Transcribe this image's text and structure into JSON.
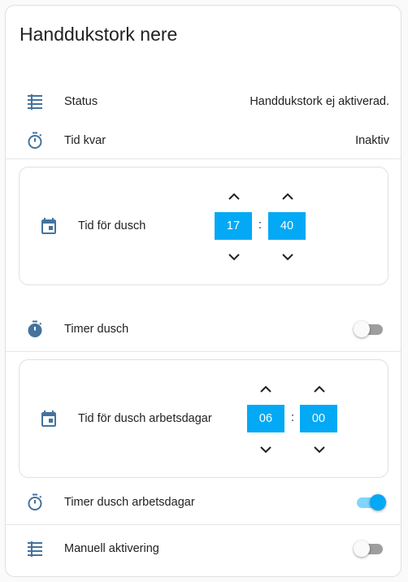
{
  "card": {
    "title": "Handdukstork nere"
  },
  "rows": {
    "status": {
      "label": "Status",
      "value": "Handdukstork ej aktiverad.",
      "icon": "list-icon"
    },
    "tid_kvar": {
      "label": "Tid kvar",
      "value": "Inaktiv",
      "icon": "timer-outline-icon"
    }
  },
  "time_dusch": {
    "label": "Tid för dusch",
    "hour": "17",
    "sep": ":",
    "minute": "40",
    "icon": "calendar-icon"
  },
  "timer_dusch": {
    "label": "Timer dusch",
    "state": "off",
    "icon": "timer-icon"
  },
  "time_arbetsdagar": {
    "label": "Tid för dusch arbetsdagar",
    "hour": "06",
    "sep": ":",
    "minute": "00",
    "icon": "calendar-icon"
  },
  "timer_arbetsdagar": {
    "label": "Timer dusch arbetsdagar",
    "state": "on",
    "icon": "timer-outline-icon"
  },
  "manuell": {
    "label": "Manuell aktivering",
    "state": "off",
    "icon": "list-icon"
  },
  "colors": {
    "accent": "#03a9f4",
    "icon": "#44739e",
    "toggle_off": "#9e9e9e"
  }
}
